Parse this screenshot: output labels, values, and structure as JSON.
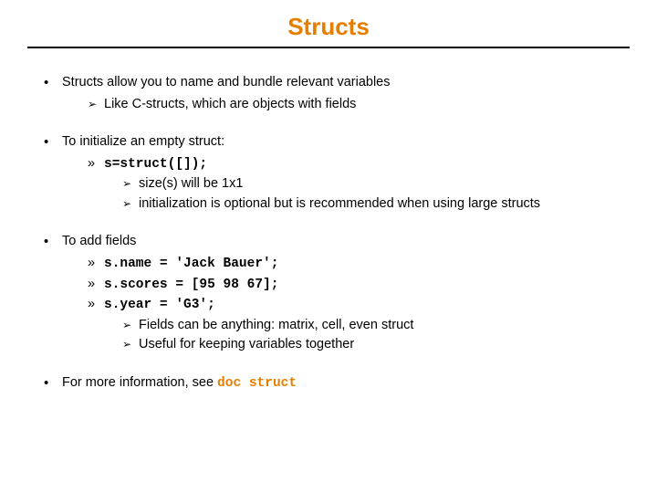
{
  "title": "Structs",
  "b1": {
    "head": "Structs allow you to name and bundle relevant variables",
    "sub1": "Like C-structs, which are objects with fields"
  },
  "b2": {
    "head": "To initialize an empty struct:",
    "code": "s=struct([]);",
    "sub1": "size(s) will be 1x1",
    "sub2": "initialization is optional but is recommended when using large structs"
  },
  "b3": {
    "head": "To add fields",
    "code1": "s.name = 'Jack Bauer';",
    "code2": "s.scores = [95 98 67];",
    "code3": "s.year = 'G3';",
    "sub1": "Fields can be anything: matrix, cell, even struct",
    "sub2": "Useful for keeping variables together"
  },
  "b4": {
    "head_pre": "For more information, see ",
    "head_code": "doc struct"
  }
}
